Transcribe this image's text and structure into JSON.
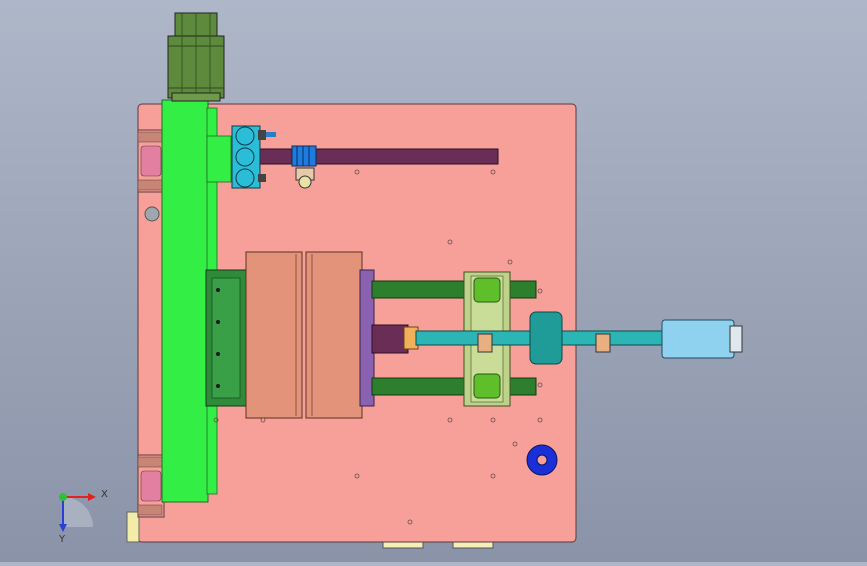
{
  "viewport": {
    "background_top": "#aeb7c8",
    "background_bottom": "#8a93a8"
  },
  "triad": {
    "x_label": "X",
    "y_label": "Y",
    "x_color": "#e0231f",
    "y_color": "#2a3fd6",
    "origin_color": "#2fbf3a"
  },
  "palette": {
    "base_plate": "#f7a099",
    "green_plate": "#33ee44",
    "motor": "#5d8a3c",
    "mold_block": "#e3937a",
    "dark_green": "#2f8a3a",
    "rod": "#2d7e2d",
    "shaft": "#2bb5b5",
    "cylinder": "#8fd2f0",
    "purple_rod": "#6a2d55",
    "blue_ring": "#1b2fd6",
    "coupling": "#2bbcd8"
  }
}
